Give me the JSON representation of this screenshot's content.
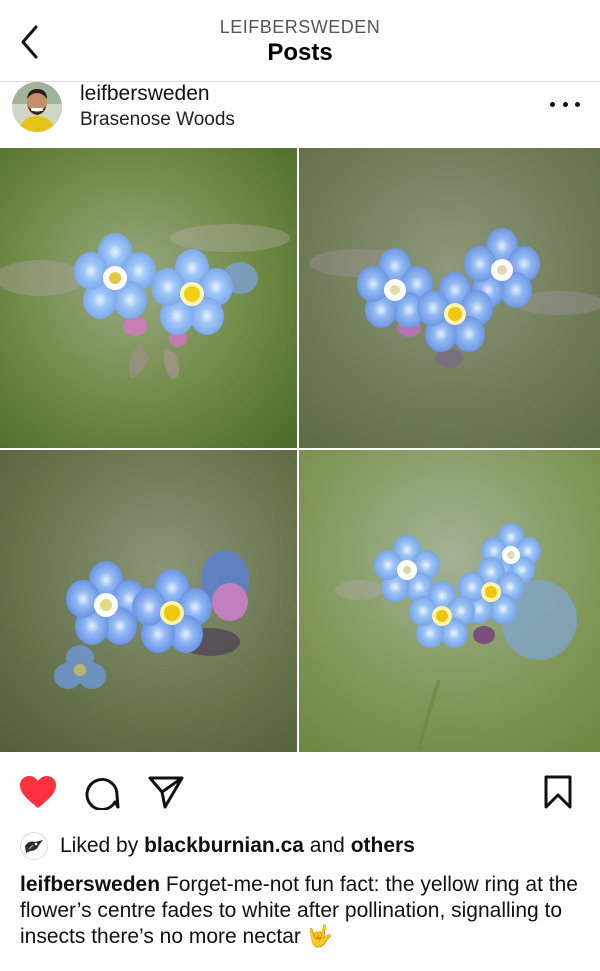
{
  "header": {
    "username": "LEIFBERSWEDEN",
    "title": "Posts"
  },
  "post": {
    "username": "leifbersweden",
    "location": "Brasenose Woods"
  },
  "photos": [
    {
      "name": "photo-top-left",
      "icon": "forget-me-not-photo"
    },
    {
      "name": "photo-top-right",
      "icon": "forget-me-not-photo"
    },
    {
      "name": "photo-bottom-left",
      "icon": "forget-me-not-photo"
    },
    {
      "name": "photo-bottom-right",
      "icon": "forget-me-not-photo"
    }
  ],
  "actions": {
    "like_icon": "heart-filled-icon",
    "comment_icon": "comment-icon",
    "share_icon": "send-icon",
    "save_icon": "bookmark-icon",
    "like_color": "#ff3040"
  },
  "likes": {
    "prefix": "Liked by",
    "liker": "blackburnian.ca",
    "conjunction": "and",
    "others": "others"
  },
  "caption": {
    "username": "leifbersweden",
    "text": "Forget-me-not fun fact: the yellow ring at the flower’s centre fades to white after pollination, signalling to insects there’s no more nectar 🤟"
  }
}
